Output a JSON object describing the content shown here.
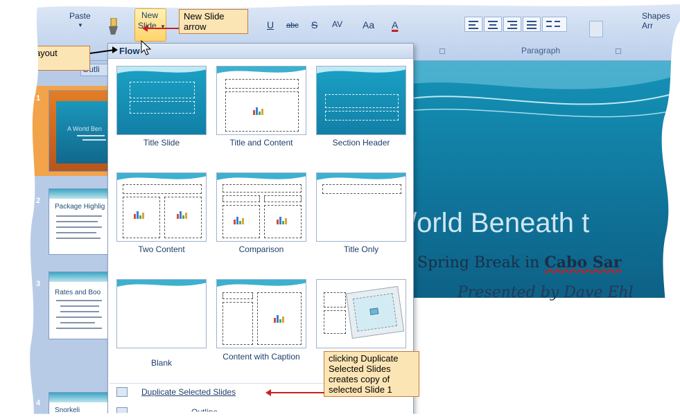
{
  "ribbon": {
    "paste_label": "Paste",
    "new_slide_line1": "New",
    "new_slide_line2": "Slide",
    "paragraph_label": "Paragraph",
    "shapes_label": "Shapes Arr",
    "font_tools": [
      "U",
      "abc",
      "S",
      "AV",
      "Aa",
      "A"
    ]
  },
  "left_pane": {
    "outline_tab": "Outli",
    "slides": [
      {
        "number": "1",
        "title": "A World Ben"
      },
      {
        "number": "2",
        "title": "Package Highlig"
      },
      {
        "number": "3",
        "title": "Rates and Boo"
      },
      {
        "number": "4",
        "title": "Snorkeli"
      }
    ]
  },
  "gallery": {
    "header": "Flow",
    "layouts": [
      {
        "label": "Title Slide"
      },
      {
        "label": "Title and Content"
      },
      {
        "label": "Section Header"
      },
      {
        "label": "Two Content"
      },
      {
        "label": "Comparison"
      },
      {
        "label": "Title Only"
      },
      {
        "label": "Blank"
      },
      {
        "label": "Content with Caption"
      },
      {
        "label": ""
      }
    ],
    "menu": [
      {
        "label": "Duplicate Selected Slides"
      },
      {
        "label": "Outline..."
      }
    ]
  },
  "slide": {
    "title": "/orld Beneath t",
    "subtitle_plain": "Spring Break in ",
    "subtitle_bold": "Cabo Sar",
    "presenter": "Presented by Dave Ehl"
  },
  "callouts": {
    "new_slide_arrow": "New Slide arrow",
    "flow_gallery": "Flow layout gallery",
    "duplicate": "clicking Duplicate Selected Slides creates copy of selected Slide 1"
  },
  "colors": {
    "highlight": "#ffd36a",
    "callout_bg": "#fce5b5",
    "arrow": "#cc2020",
    "slide_bg": "#0f6f95"
  }
}
